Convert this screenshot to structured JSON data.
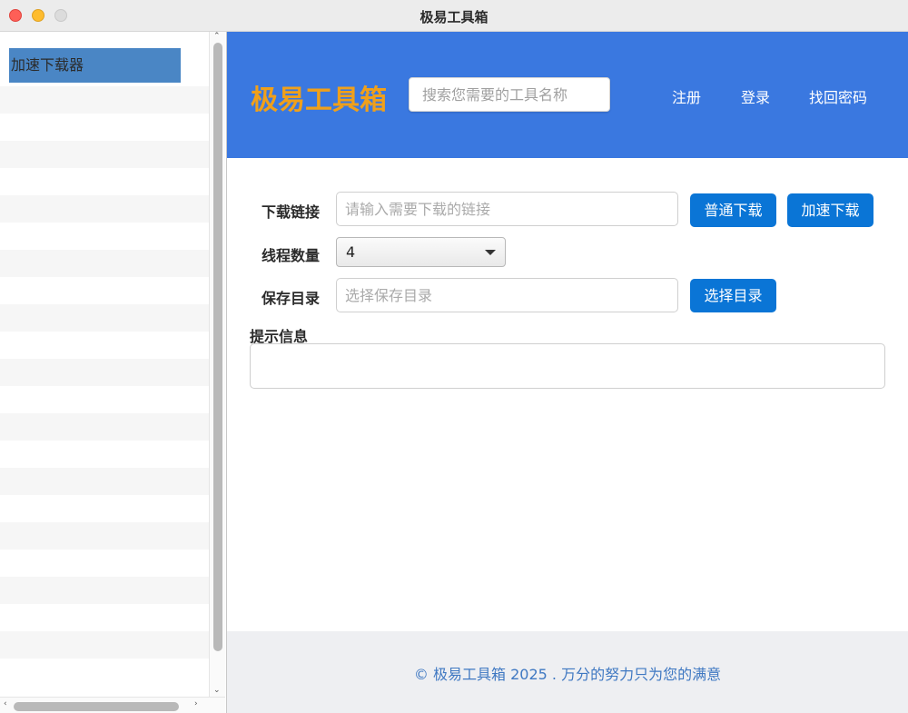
{
  "window": {
    "title": "极易工具箱"
  },
  "sidebar": {
    "items": [
      {
        "label": "加速下载器",
        "selected": true
      }
    ]
  },
  "header": {
    "brand": "极易工具箱",
    "search_placeholder": "搜索您需要的工具名称",
    "nav": [
      {
        "label": "注册"
      },
      {
        "label": "登录"
      },
      {
        "label": "找回密码"
      }
    ]
  },
  "form": {
    "download_link": {
      "label": "下载链接",
      "placeholder": "请输入需要下载的链接",
      "value": ""
    },
    "normal_download_button": "普通下载",
    "accelerated_download_button": "加速下载",
    "threads": {
      "label": "线程数量",
      "value": "4"
    },
    "save_dir": {
      "label": "保存目录",
      "placeholder": "选择保存目录",
      "value": ""
    },
    "choose_dir_button": "选择目录",
    "message": {
      "label": "提示信息",
      "value": ""
    }
  },
  "footer": {
    "text": "© 极易工具箱 2025 . 万分的努力只为您的满意"
  },
  "colors": {
    "header_bg": "#3a78e0",
    "brand": "#f0a01a",
    "button": "#0a75d6",
    "sidebar_selected": "#4a86c5",
    "footer_text": "#3f78c2"
  }
}
